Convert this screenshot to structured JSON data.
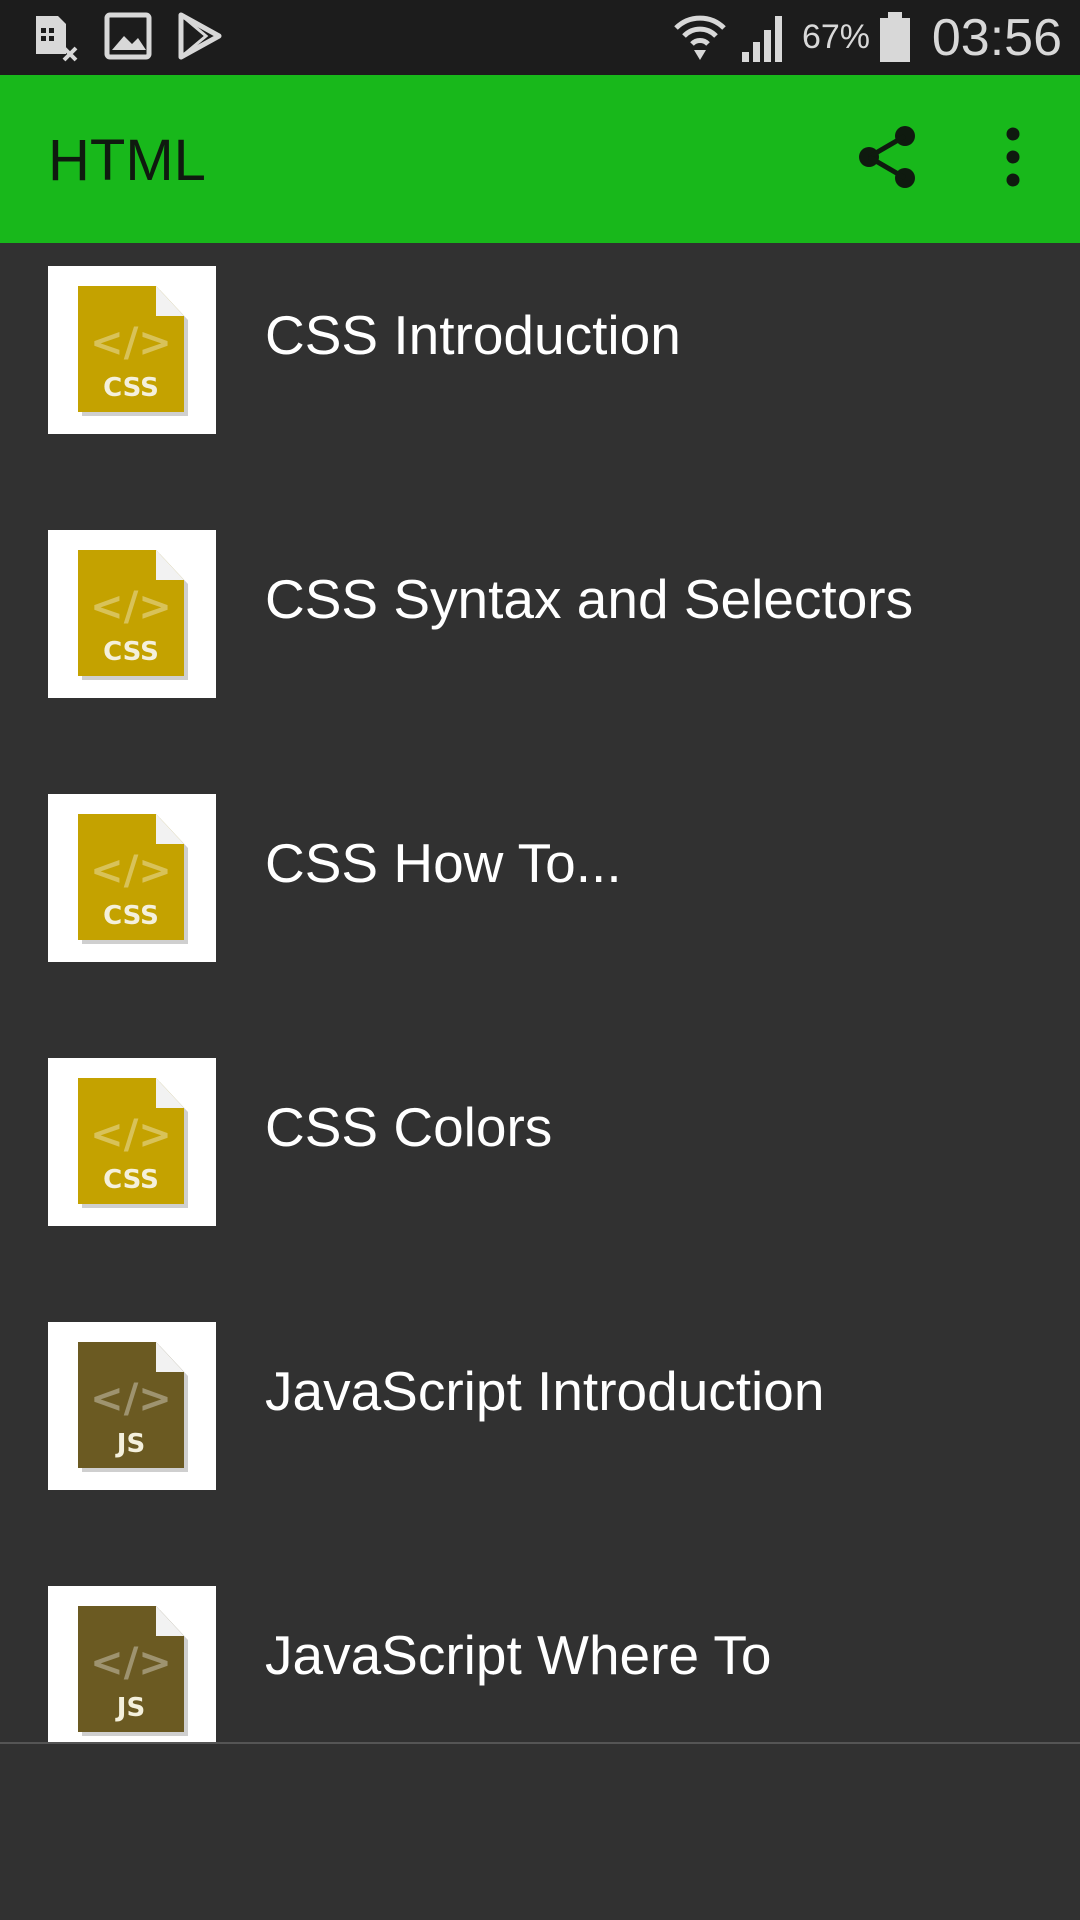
{
  "status_bar": {
    "icons": [
      "notification-sim-icon",
      "gallery-icon",
      "play-store-icon",
      "wifi-icon",
      "signal-icon",
      "battery-icon"
    ],
    "battery": "67%",
    "time": "03:56"
  },
  "app_bar": {
    "title": "HTML",
    "actions": [
      "share-icon",
      "more-vert-icon"
    ],
    "color": "#18b81b"
  },
  "list": {
    "items": [
      {
        "label": "CSS Introduction",
        "badge": "CSS",
        "icon_color": "#c4a200"
      },
      {
        "label": "CSS Syntax and Selectors",
        "badge": "CSS",
        "icon_color": "#c4a200"
      },
      {
        "label": "CSS How To...",
        "badge": "CSS",
        "icon_color": "#c4a200"
      },
      {
        "label": "CSS Colors",
        "badge": "CSS",
        "icon_color": "#c4a200"
      },
      {
        "label": "JavaScript Introduction",
        "badge": "JS",
        "icon_color": "#6b5a22"
      },
      {
        "label": "JavaScript Where To",
        "badge": "JS",
        "icon_color": "#6b5a22"
      }
    ]
  }
}
